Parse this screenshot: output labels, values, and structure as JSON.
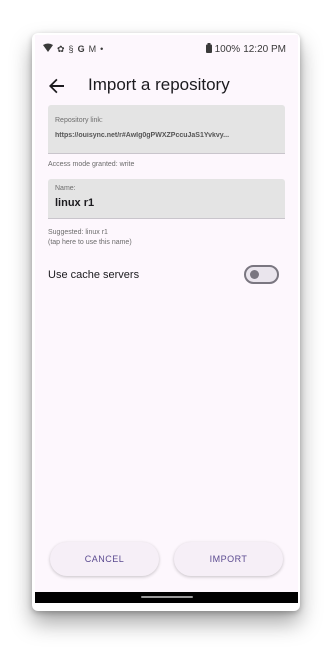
{
  "status_bar": {
    "battery": "100%",
    "time": "12:20 PM",
    "icons": [
      "wifi-icon",
      "settings-icon",
      "sync-icon",
      "google-icon",
      "gmail-icon",
      "dot-icon",
      "battery-icon"
    ]
  },
  "app_bar": {
    "title": "Import a repository"
  },
  "repo_link": {
    "label": "Repository link:",
    "value": "https://ouisync.net/r#AwIg0gPWXZPccuJaS1Yvkvy..."
  },
  "access_mode": "Access mode granted: write",
  "name_field": {
    "label": "Name:",
    "value": "linux r1"
  },
  "suggestion": {
    "line1": "Suggested: linux r1",
    "line2": "(tap here to use this name)"
  },
  "cache_servers": {
    "label": "Use cache servers",
    "enabled": false
  },
  "buttons": {
    "cancel": "CANCEL",
    "import": "IMPORT"
  },
  "colors": {
    "background": "#fdf7fd",
    "accent": "#5b4a90",
    "field": "#e4e4e4"
  }
}
